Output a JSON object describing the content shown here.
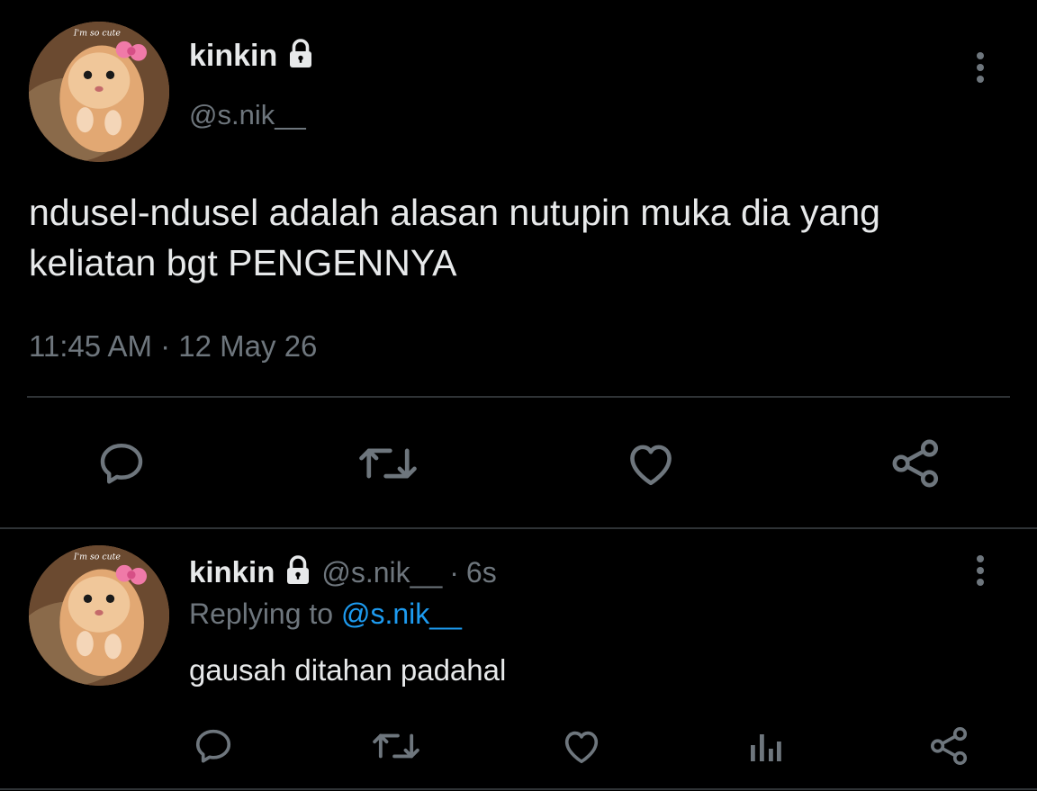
{
  "main_tweet": {
    "display_name": "kinkin",
    "handle": "@s.nik__",
    "avatar_caption": "I'm so cute",
    "text_line1": "ndusel-ndusel adalah alasan nutupin muka dia yang",
    "text_line2": "keliatan bgt PENGENNYA",
    "timestamp": "11:45 AM · 12 May 26"
  },
  "reply_tweet": {
    "display_name": "kinkin",
    "handle": "@s.nik__",
    "separator": "·",
    "time_ago": "6s",
    "replying_to_label": "Replying to",
    "replying_to_handle": "@s.nik__",
    "text": "gausah ditahan padahal",
    "avatar_caption": "I'm so cute"
  },
  "icons": {
    "reply": "reply-icon",
    "retweet": "retweet-icon",
    "like": "heart-icon",
    "share": "share-icon",
    "analytics": "analytics-icon",
    "more": "more-vertical-icon",
    "lock": "lock-icon"
  },
  "colors": {
    "background": "#000000",
    "text": "#e7e9ea",
    "muted": "#6e767d",
    "link": "#1d9bf0",
    "divider": "#2f3336"
  }
}
